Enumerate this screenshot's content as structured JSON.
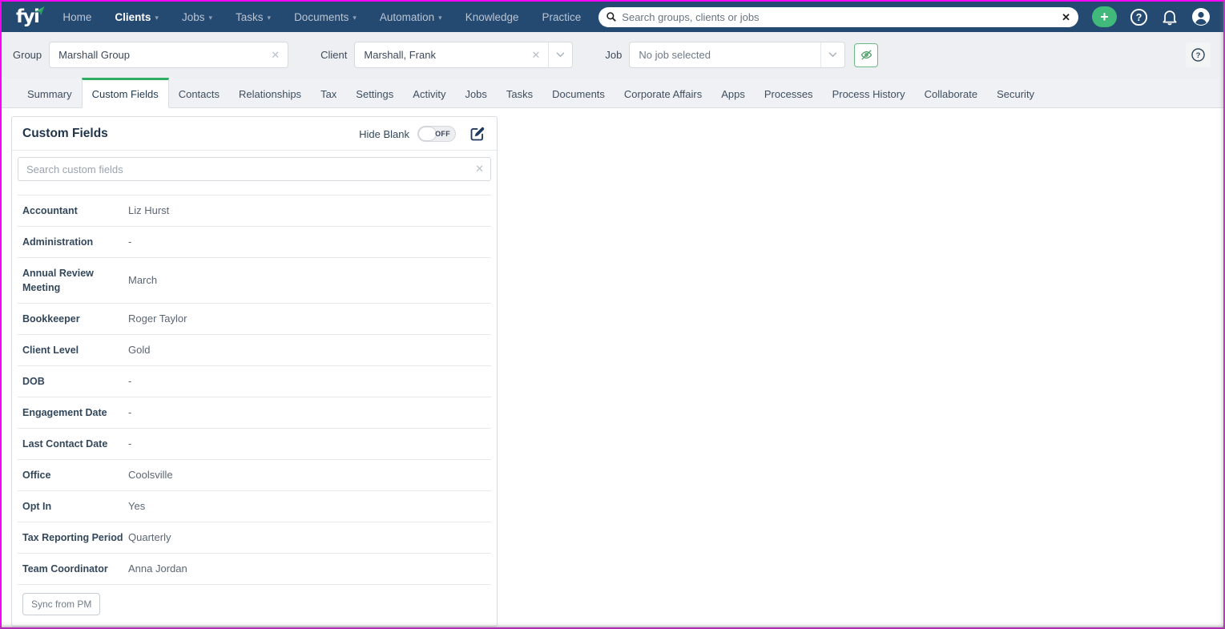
{
  "brand": {
    "logo_text": "fyi"
  },
  "nav": {
    "items": [
      {
        "label": "Home",
        "caret": false,
        "active": false
      },
      {
        "label": "Clients",
        "caret": true,
        "active": true
      },
      {
        "label": "Jobs",
        "caret": true,
        "active": false
      },
      {
        "label": "Tasks",
        "caret": true,
        "active": false
      },
      {
        "label": "Documents",
        "caret": true,
        "active": false
      },
      {
        "label": "Automation",
        "caret": true,
        "active": false
      },
      {
        "label": "Knowledge",
        "caret": false,
        "active": false
      },
      {
        "label": "Practice",
        "caret": false,
        "active": false
      }
    ],
    "search_placeholder": "Search groups, clients or jobs"
  },
  "filters": {
    "group_label": "Group",
    "group_value": "Marshall Group",
    "client_label": "Client",
    "client_value": "Marshall, Frank",
    "job_label": "Job",
    "job_placeholder": "No job selected"
  },
  "tabs": [
    {
      "label": "Summary",
      "active": false
    },
    {
      "label": "Custom Fields",
      "active": true
    },
    {
      "label": "Contacts",
      "active": false
    },
    {
      "label": "Relationships",
      "active": false
    },
    {
      "label": "Tax",
      "active": false
    },
    {
      "label": "Settings",
      "active": false
    },
    {
      "label": "Activity",
      "active": false
    },
    {
      "label": "Jobs",
      "active": false
    },
    {
      "label": "Tasks",
      "active": false
    },
    {
      "label": "Documents",
      "active": false
    },
    {
      "label": "Corporate Affairs",
      "active": false
    },
    {
      "label": "Apps",
      "active": false
    },
    {
      "label": "Processes",
      "active": false
    },
    {
      "label": "Process History",
      "active": false
    },
    {
      "label": "Collaborate",
      "active": false
    },
    {
      "label": "Security",
      "active": false
    }
  ],
  "panel": {
    "title": "Custom Fields",
    "hide_blank_label": "Hide Blank",
    "toggle_state": "OFF",
    "search_placeholder": "Search custom fields",
    "fields": [
      {
        "label": "Accountant",
        "value": "Liz Hurst"
      },
      {
        "label": "Administration",
        "value": "-"
      },
      {
        "label": "Annual Review Meeting",
        "value": "March"
      },
      {
        "label": "Bookkeeper",
        "value": "Roger Taylor"
      },
      {
        "label": "Client Level",
        "value": "Gold"
      },
      {
        "label": "DOB",
        "value": "-"
      },
      {
        "label": "Engagement Date",
        "value": "-"
      },
      {
        "label": "Last Contact Date",
        "value": "-"
      },
      {
        "label": "Office",
        "value": "Coolsville"
      },
      {
        "label": "Opt In",
        "value": "Yes"
      },
      {
        "label": "Tax Reporting Period",
        "value": "Quarterly"
      },
      {
        "label": "Team Coordinator",
        "value": "Anna Jordan"
      }
    ],
    "sync_button_label": "Sync from PM"
  },
  "icons": {
    "clear": "✕",
    "caret": "▾",
    "plus": "+"
  },
  "colors": {
    "nav_blue": "#254a72",
    "accent_green": "#2fae63",
    "button_green": "#41b97a",
    "frame_magenta": "#ff00ff"
  }
}
